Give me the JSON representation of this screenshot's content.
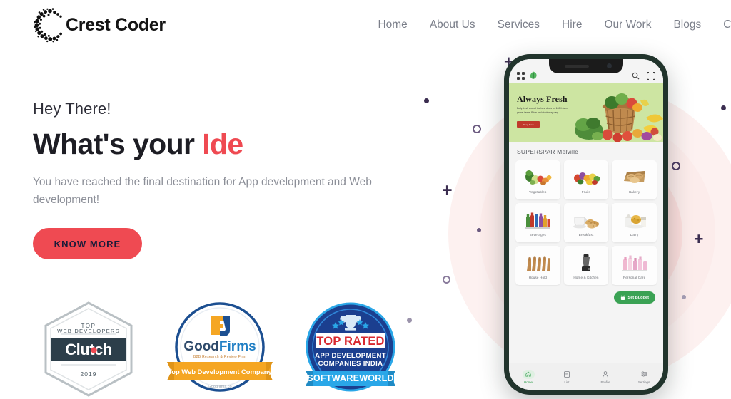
{
  "brand": {
    "name": "Crest Coder",
    "logo_icon": "dotted-c-logo-icon",
    "accent_color": "#ef4a52",
    "heading_color": "#1d1d24",
    "nav_color": "#7b7f8a"
  },
  "nav": {
    "items": [
      {
        "label": "Home"
      },
      {
        "label": "About Us"
      },
      {
        "label": "Services"
      },
      {
        "label": "Hire"
      },
      {
        "label": "Our Work"
      },
      {
        "label": "Blogs"
      },
      {
        "label": "Cont"
      }
    ]
  },
  "hero": {
    "eyebrow": "Hey There!",
    "headline_static": "What's your ",
    "headline_accent": "Ide",
    "subtext": "You have reached the final destination for App development and Web development!",
    "cta_label": "KNOW MORE"
  },
  "badges": [
    {
      "name": "clutch-badge",
      "line1": "TOP",
      "line2": "WEB DEVELOPERS",
      "wordmark": "Clutch",
      "year": "2019"
    },
    {
      "name": "goodfirms-badge",
      "wordmark_a": "Good",
      "wordmark_b": "Firms",
      "tagline": "B2B Research & Review Firm",
      "ribbon": "Top Web Development Company",
      "footer": "Goodfirms.co"
    },
    {
      "name": "softwareworld-badge",
      "icon": "trophy-icon",
      "line1": "TOP RATED",
      "line2": "APP DEVELOPMENT",
      "line3": "COMPANIES INDIA",
      "ribbon": "SOFTWAREWORLD"
    }
  ],
  "phone_app": {
    "topbar": {
      "grid_icon": "grid-menu-icon",
      "leaf_icon": "green-leaf-icon",
      "search_icon": "search-icon",
      "scan_icon": "scan-icon"
    },
    "banner": {
      "title": "Always Fresh",
      "subtitle": "Daily fresh and all the best deals on 100% farm grown items. Price and stock may vary.",
      "button_label": "Shop Now",
      "art_icon": "vegetable-basket-icon",
      "bg_color": "#cde5a2"
    },
    "store_name": "SUPERSPAR Melville",
    "categories": [
      {
        "label": "Vegetables",
        "icon": "vegetables-icon"
      },
      {
        "label": "Fruits",
        "icon": "fruits-icon"
      },
      {
        "label": "Bakery",
        "icon": "bakery-icon"
      },
      {
        "label": "Beverages",
        "icon": "beverages-icon"
      },
      {
        "label": "Breakfast",
        "icon": "breakfast-icon"
      },
      {
        "label": "Dairy",
        "icon": "dairy-icon"
      },
      {
        "label": "House Hold",
        "icon": "household-icon"
      },
      {
        "label": "Home & Kitchen",
        "icon": "home-kitchen-icon"
      },
      {
        "label": "Personal Care",
        "icon": "personal-care-icon"
      }
    ],
    "budget_button": {
      "label": "Set Budget",
      "icon": "budget-icon",
      "color": "#3aa254"
    },
    "bottom_nav": [
      {
        "label": "Home",
        "icon": "home-icon",
        "active": true
      },
      {
        "label": "List",
        "icon": "list-icon",
        "active": false
      },
      {
        "label": "Profile",
        "icon": "profile-icon",
        "active": false
      },
      {
        "label": "Settings",
        "icon": "settings-icon",
        "active": false
      }
    ]
  },
  "decor": {
    "dot_color": "#3b2d50",
    "ring_color": "#6b5a80",
    "muted_dot_color": "#9b93ab",
    "circle_outer": "#fdf1f0",
    "circle_mid": "#fceceb",
    "circle_inner": "#fbdedd"
  }
}
